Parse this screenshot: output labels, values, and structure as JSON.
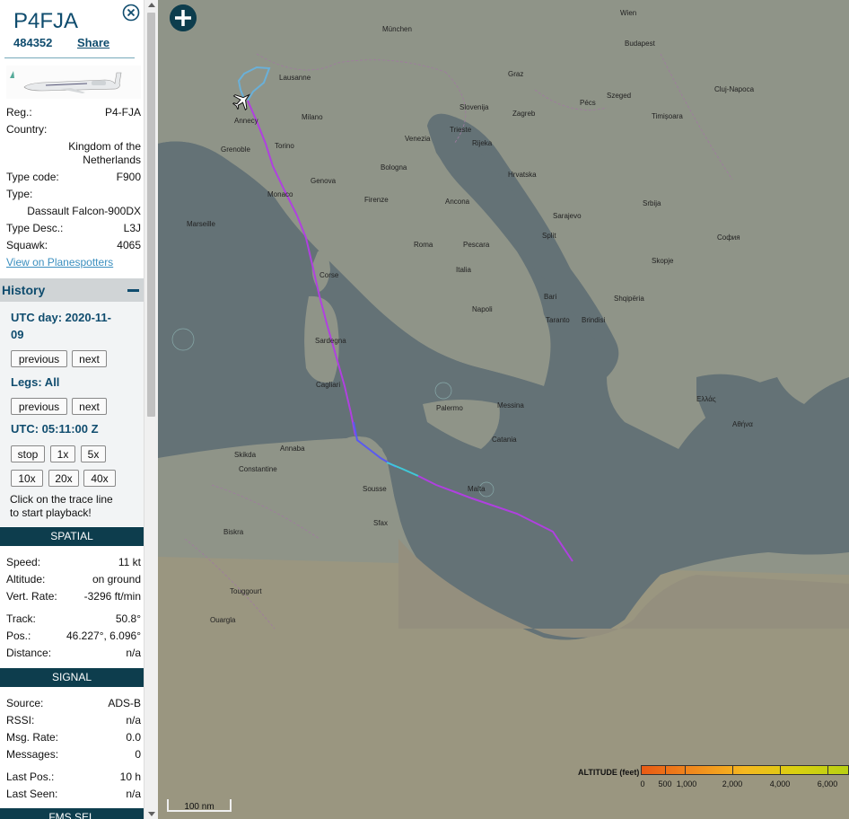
{
  "aircraft": {
    "callsign": "P4FJA",
    "hex": "484352",
    "share_label": "Share",
    "registration_label": "Reg.:",
    "registration": "P4-FJA",
    "country_label": "Country:",
    "country_line1": "Kingdom of the",
    "country_line2": "Netherlands",
    "type_code_label": "Type code:",
    "type_code": "F900",
    "type_label": "Type:",
    "type": "Dassault Falcon-900DX",
    "type_desc_label": "Type Desc.:",
    "type_desc": "L3J",
    "squawk_label": "Squawk:",
    "squawk": "4065",
    "planespotters_link": "View on Planespotters"
  },
  "history": {
    "title": "History",
    "utc_day_line1": "UTC day: 2020-11-",
    "utc_day_line2": "09",
    "previous_label": "previous",
    "next_label": "next",
    "legs_label": "Legs: All",
    "utc_time": "UTC: 05:11:00 Z",
    "stop_label": "stop",
    "speed_1x": "1x",
    "speed_5x": "5x",
    "speed_10x": "10x",
    "speed_20x": "20x",
    "speed_40x": "40x",
    "hint_line1": "Click on the trace line",
    "hint_line2": "to start playback!"
  },
  "spatial": {
    "title": "SPATIAL",
    "speed_label": "Speed:",
    "speed": "11 kt",
    "altitude_label": "Altitude:",
    "altitude": "on ground",
    "vert_rate_label": "Vert. Rate:",
    "vert_rate": "-3296 ft/min",
    "track_label": "Track:",
    "track": "50.8°",
    "pos_label": "Pos.:",
    "pos": "46.227°, 6.096°",
    "distance_label": "Distance:",
    "distance": "n/a"
  },
  "signal": {
    "title": "SIGNAL",
    "source_label": "Source:",
    "source": "ADS-B",
    "rssi_label": "RSSI:",
    "rssi": "n/a",
    "msg_rate_label": "Msg. Rate:",
    "msg_rate": "0.0",
    "messages_label": "Messages:",
    "messages": "0",
    "last_pos_label": "Last Pos.:",
    "last_pos": "10 h",
    "last_seen_label": "Last Seen:",
    "last_seen": "n/a"
  },
  "next_section": "FMS SEL",
  "map": {
    "scale_label": "100 nm",
    "altitude_legend_title": "ALTITUDE (feet)",
    "altitude_ticks": [
      "0",
      "500",
      "1,000",
      "2,000",
      "4,000",
      "6,000"
    ],
    "cities": [
      {
        "name": "München"
      },
      {
        "name": "Wien"
      },
      {
        "name": "Budapest"
      },
      {
        "name": "Zagreb"
      },
      {
        "name": "Slovenija"
      },
      {
        "name": "Hrvatska"
      },
      {
        "name": "Venezia"
      },
      {
        "name": "Milano"
      },
      {
        "name": "Genova"
      },
      {
        "name": "Bologna"
      },
      {
        "name": "Firenze"
      },
      {
        "name": "Monaco"
      },
      {
        "name": "Marseille"
      },
      {
        "name": "Corse"
      },
      {
        "name": "Sardegna"
      },
      {
        "name": "Italia"
      },
      {
        "name": "Roma"
      },
      {
        "name": "Napoli"
      },
      {
        "name": "Bari"
      },
      {
        "name": "Palermo"
      },
      {
        "name": "Messina"
      },
      {
        "name": "Catania"
      },
      {
        "name": "Malta"
      },
      {
        "name": "Annaba"
      },
      {
        "name": "Constantine"
      },
      {
        "name": "Skikda"
      },
      {
        "name": "Sousse"
      },
      {
        "name": "Sfax"
      },
      {
        "name": "Biskra"
      },
      {
        "name": "Touggourt"
      },
      {
        "name": "Ouargla"
      },
      {
        "name": "Lausanne"
      },
      {
        "name": "Annecy"
      },
      {
        "name": "Grenoble"
      },
      {
        "name": "Torino"
      },
      {
        "name": "Ancona"
      },
      {
        "name": "Pescara"
      },
      {
        "name": "Taranto"
      },
      {
        "name": "Cagliari"
      },
      {
        "name": "Brindisi"
      },
      {
        "name": "Shqipëria"
      },
      {
        "name": "Ελλάς"
      },
      {
        "name": "Αθήνα"
      },
      {
        "name": "София"
      },
      {
        "name": "Skopje"
      },
      {
        "name": "Srbija"
      },
      {
        "name": "Sarajevo"
      },
      {
        "name": "Timișoara"
      },
      {
        "name": "Cluj-Napoca"
      },
      {
        "name": "Pécs"
      },
      {
        "name": "Szeged"
      },
      {
        "name": "Graz"
      },
      {
        "name": "Trieste"
      },
      {
        "name": "Rijeka"
      },
      {
        "name": "Split"
      }
    ]
  },
  "colors": {
    "accent": "#0f4c6e",
    "section_bar": "#0d3d4d",
    "trace": "#b040e0",
    "link": "#3b8fbf"
  }
}
